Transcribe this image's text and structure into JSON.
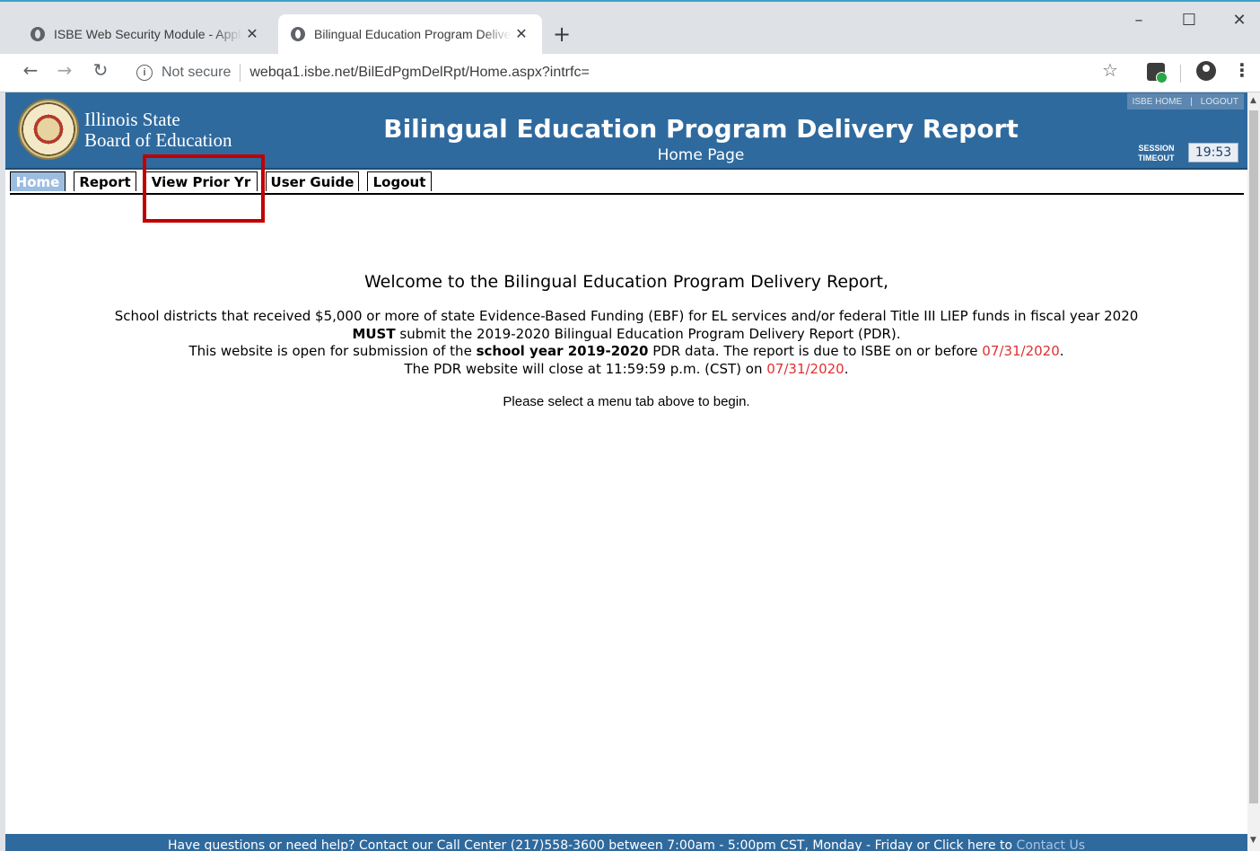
{
  "browser": {
    "tabs": [
      {
        "title": "ISBE Web Security Module - Application"
      },
      {
        "title": "Bilingual Education Program Delivery"
      }
    ],
    "new_tab": "+",
    "tab_close": "✕",
    "window": {
      "minimize": "–",
      "maximize": "☐",
      "close": "✕"
    },
    "security_label": "Not secure",
    "url": "webqa1.isbe.net/BilEdPgmDelRpt/Home.aspx?intrfc="
  },
  "header": {
    "org_line1": "Illinois State",
    "org_line2": "Board of Education",
    "title": "Bilingual Education Program Delivery Report",
    "subtitle": "Home Page",
    "top_links": {
      "home": "ISBE HOME",
      "separator": "|",
      "logout": "LOGOUT"
    },
    "session_label_line1": "SESSION",
    "session_label_line2": "TIMEOUT",
    "session_time": "19:53"
  },
  "nav": {
    "tabs": [
      {
        "label": "Home",
        "active": true
      },
      {
        "label": "Report",
        "active": false
      },
      {
        "label": "View Prior Yr",
        "active": false
      },
      {
        "label": "User Guide",
        "active": false
      },
      {
        "label": "Logout",
        "active": false
      }
    ]
  },
  "content": {
    "welcome": "Welcome to the Bilingual Education Program Delivery Report,",
    "line1": "School districts that received $5,000 or more of state Evidence-Based Funding (EBF) for EL services and/or federal Title III LIEP funds in fiscal year 2020",
    "line2_bold": "MUST",
    "line2_rest": " submit the 2019-2020 Bilingual Education Program Delivery Report (PDR).",
    "line3_a": "This website is open for submission of the ",
    "line3_bold": "school year 2019-2020",
    "line3_b": " PDR data. The report is due to ISBE on or before ",
    "due_date": "07/31/2020",
    "line3_end": ".",
    "line4_a": "The PDR website will close at 11:59:59 p.m. (CST) on ",
    "close_date": "07/31/2020",
    "line4_end": ".",
    "select_msg": "Please select a menu tab above to begin."
  },
  "footer": {
    "text": "Have questions or need help? Contact our Call Center (217)558-3600 between 7:00am - 5:00pm CST, Monday - Friday or Click here to ",
    "link": "Contact Us"
  },
  "colors": {
    "banner": "#2f6a9e",
    "active_tab": "#9dbde0",
    "highlight": "#c00000",
    "date_red": "#e03030"
  }
}
